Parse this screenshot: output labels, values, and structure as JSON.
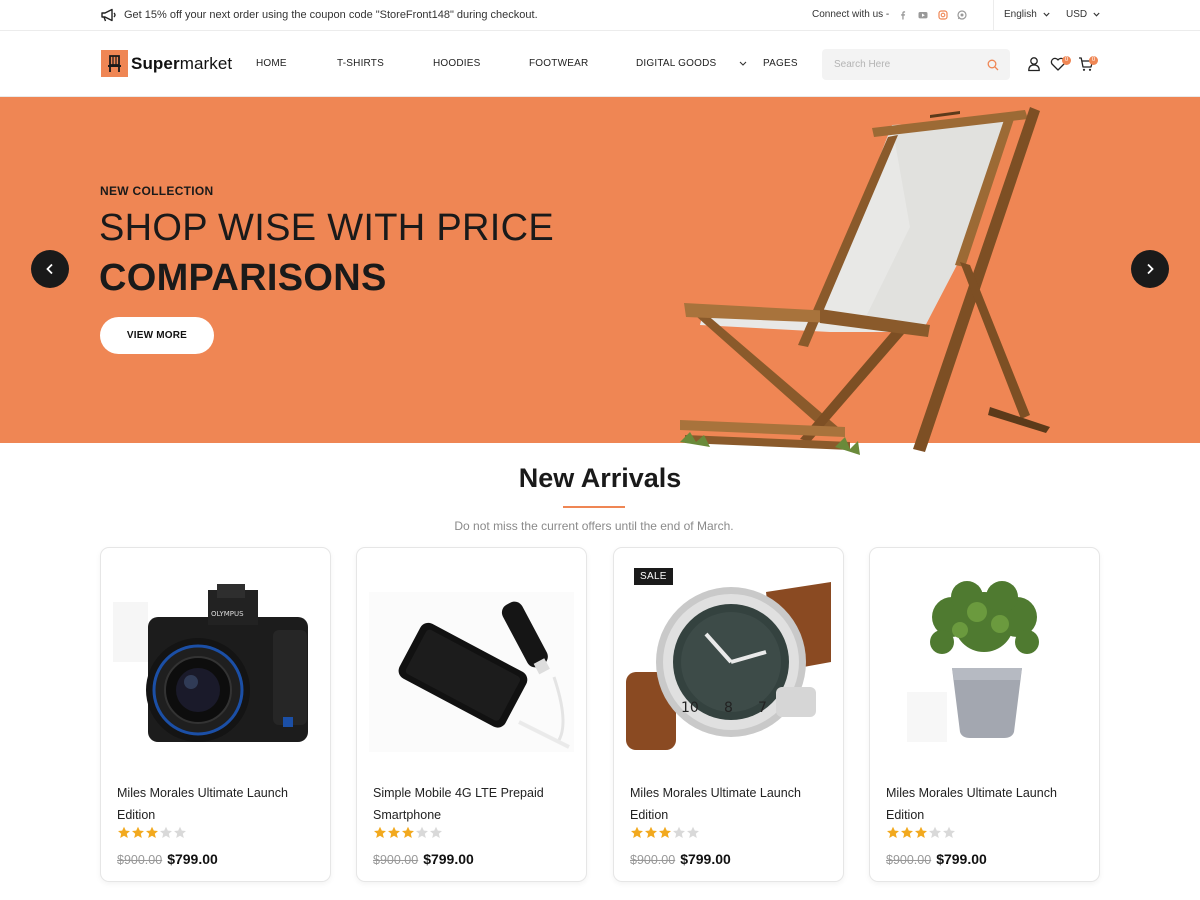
{
  "topbar": {
    "promo_text": "Get 15% off your next order using the coupon code \"StoreFront148\" during checkout.",
    "connect_label": "Connect with us -",
    "language": "English",
    "currency": "USD"
  },
  "header": {
    "logo_bold": "Super",
    "logo_light": "market",
    "nav": [
      "HOME",
      "T-SHIRTS",
      "HOODIES",
      "FOOTWEAR",
      "DIGITAL GOODS",
      "PAGES"
    ],
    "search_placeholder": "Search Here",
    "wishlist_count": "0",
    "cart_count": "0"
  },
  "hero": {
    "subtitle": "NEW COLLECTION",
    "title_line1": "SHOP WISE WITH PRICE",
    "title_line2": "COMPARISONS",
    "button": "VIEW MORE"
  },
  "section": {
    "title": "New Arrivals",
    "subtitle": "Do not miss the current offers until the end of March."
  },
  "products": [
    {
      "name": "Miles Morales Ultimate Launch Edition",
      "rating": 3,
      "old_price": "$900.00",
      "price": "$799.00",
      "badge": "",
      "image": "camera"
    },
    {
      "name": "Simple Mobile 4G LTE Prepaid Smartphone",
      "rating": 3,
      "old_price": "$900.00",
      "price": "$799.00",
      "badge": "",
      "image": "phone"
    },
    {
      "name": "Miles Morales Ultimate Launch Edition",
      "rating": 3,
      "old_price": "$900.00",
      "price": "$799.00",
      "badge": "SALE",
      "image": "watch"
    },
    {
      "name": "Miles Morales Ultimate Launch Edition",
      "rating": 3,
      "old_price": "$900.00",
      "price": "$799.00",
      "badge": "",
      "image": "plant"
    }
  ],
  "colors": {
    "accent": "#ef8654",
    "dark": "#1a1a1a",
    "star": "#f2a91e",
    "star_empty": "#d9d9d9"
  }
}
